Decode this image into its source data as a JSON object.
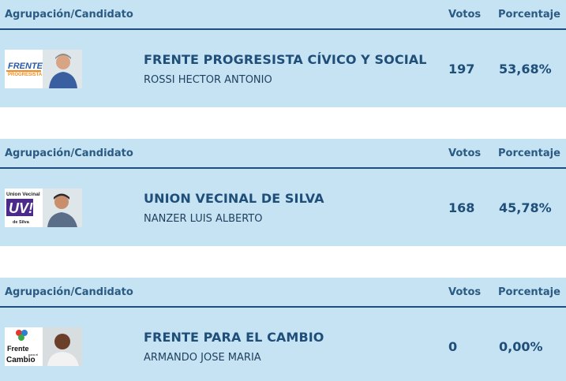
{
  "headers": {
    "party_candidate": "Agrupación/Candidato",
    "votes": "Votos",
    "percentage": "Porcentaje"
  },
  "results": [
    {
      "party": "FRENTE PROGRESISTA CÍVICO Y SOCIAL",
      "candidate": "ROSSI HECTOR ANTONIO",
      "votes": "197",
      "percentage": "53,68%",
      "logo_text": [
        "FRENTE",
        "PROGRESISTA"
      ],
      "logo_color": "#f28c1e"
    },
    {
      "party": "UNION VECINAL DE SILVA",
      "candidate": "NANZER LUIS ALBERTO",
      "votes": "168",
      "percentage": "45,78%",
      "logo_text": [
        "Union Vecinal",
        "UV!",
        "de Silva"
      ],
      "logo_color": "#4b2a8c"
    },
    {
      "party": "FRENTE PARA EL CAMBIO",
      "candidate": "ARMANDO JOSE MARIA",
      "votes": "0",
      "percentage": "0,00%",
      "logo_text": [
        "Frente",
        "para el",
        "Cambio"
      ],
      "logo_color": "#e03a2f"
    }
  ],
  "colors": {
    "row_background": "#c5e3f3",
    "header_rule": "#1f4e79",
    "text_primary": "#1f4e79"
  }
}
